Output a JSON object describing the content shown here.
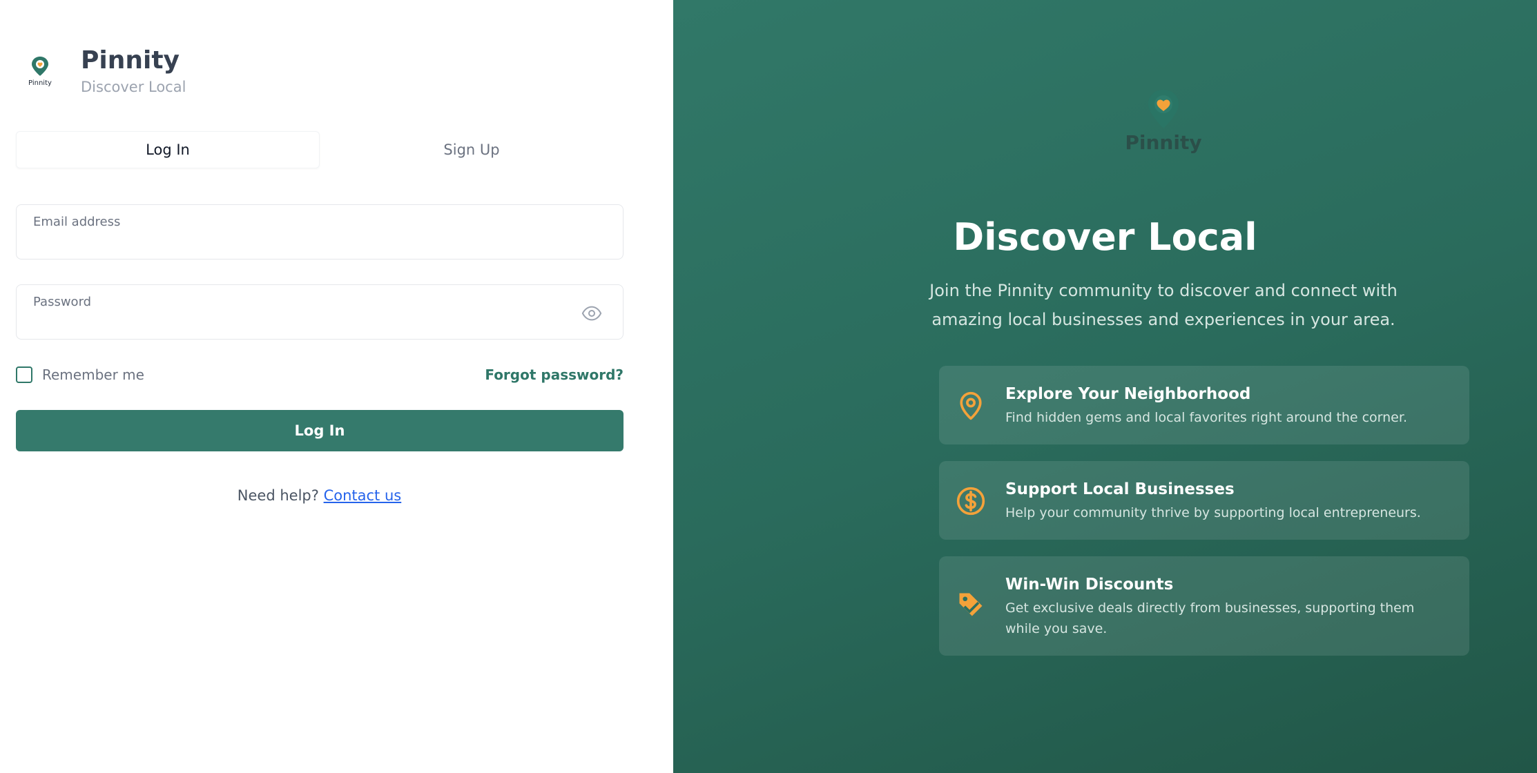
{
  "brand": {
    "title": "Pinnity",
    "subtitle": "Discover Local",
    "logo_text": "Pinnity"
  },
  "tabs": [
    {
      "label": "Log In",
      "active": true
    },
    {
      "label": "Sign Up",
      "active": false
    }
  ],
  "form": {
    "email_label": "Email address",
    "email_value": "",
    "password_label": "Password",
    "password_value": "",
    "remember_label": "Remember me",
    "remember_checked": false,
    "forgot_label": "Forgot password?",
    "submit_label": "Log In"
  },
  "help": {
    "text": "Need help?",
    "link_label": "Contact us"
  },
  "hero": {
    "logo_text": "Pinnity",
    "title": "Discover Local",
    "subtitle": "Join the Pinnity community to discover and connect with amazing local businesses and experiences in your area."
  },
  "features": [
    {
      "icon": "map-pin-icon",
      "title": "Explore Your Neighborhood",
      "description": "Find hidden gems and local favorites right around the corner."
    },
    {
      "icon": "dollar-circle-icon",
      "title": "Support Local Businesses",
      "description": "Help your community thrive by supporting local entrepreneurs."
    },
    {
      "icon": "tag-icon",
      "title": "Win-Win Discounts",
      "description": "Get exclusive deals directly from businesses, supporting them while you save."
    }
  ],
  "colors": {
    "primary": "#357a6c",
    "accent": "#f4a23a",
    "panel_dark": "#215647",
    "link": "#2563eb"
  }
}
